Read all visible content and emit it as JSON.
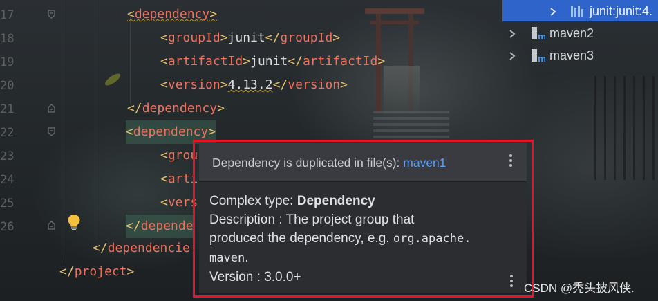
{
  "editor": {
    "line_numbers": [
      "17",
      "18",
      "19",
      "20",
      "21",
      "22",
      "23",
      "24",
      "25",
      "26"
    ],
    "lines": [
      {
        "indent": "      ",
        "open": "<",
        "name": "dependency",
        "close": ">",
        "text": "",
        "end_open": "",
        "end_name": "",
        "end_close": ""
      },
      {
        "indent": "        ",
        "open": "<",
        "name": "groupId",
        "close": ">",
        "text": "junit",
        "end_open": "</",
        "end_name": "groupId",
        "end_close": ">"
      },
      {
        "indent": "        ",
        "open": "<",
        "name": "artifactId",
        "close": ">",
        "text": "junit",
        "end_open": "</",
        "end_name": "artifactId",
        "end_close": ">"
      },
      {
        "indent": "        ",
        "open": "<",
        "name": "version",
        "close": ">",
        "text": "4.13.2",
        "end_open": "</",
        "end_name": "version",
        "end_close": ">"
      },
      {
        "indent": "      ",
        "open": "</",
        "name": "dependency",
        "close": ">",
        "text": "",
        "end_open": "",
        "end_name": "",
        "end_close": ""
      },
      {
        "indent": "      ",
        "open": "<",
        "name": "dependency",
        "close": ">",
        "text": "",
        "end_open": "",
        "end_name": "",
        "end_close": ""
      },
      {
        "indent": "        ",
        "open": "<",
        "name": "grou",
        "close": "",
        "text": "",
        "end_open": "",
        "end_name": "",
        "end_close": ""
      },
      {
        "indent": "        ",
        "open": "<",
        "name": "arti",
        "close": "",
        "text": "",
        "end_open": "",
        "end_name": "",
        "end_close": ""
      },
      {
        "indent": "        ",
        "open": "<",
        "name": "vers",
        "close": "",
        "text": "",
        "end_open": "",
        "end_name": "",
        "end_close": ""
      },
      {
        "indent": "      ",
        "open": "</",
        "name": "depende",
        "close": "",
        "text": "",
        "end_open": "",
        "end_name": "",
        "end_close": ""
      },
      {
        "indent": "    ",
        "open": "</",
        "name": "dependencie",
        "close": "",
        "text": "",
        "end_open": "",
        "end_name": "",
        "end_close": ""
      },
      {
        "indent": "  ",
        "open": "</",
        "name": "project",
        "close": ">",
        "text": "",
        "end_open": "",
        "end_name": "",
        "end_close": ""
      }
    ]
  },
  "project_tree": {
    "selected_item": "junit:junit:4.",
    "items": [
      "maven2",
      "maven3"
    ]
  },
  "popup": {
    "header_prefix": "Dependency is duplicated in file(s): ",
    "header_link": "maven1",
    "complex_type_label": "Complex type: ",
    "complex_type_value": "Dependency",
    "description_line1": "Description : The project group that",
    "description_line2_prefix": "produced the dependency, e.g. ",
    "description_code_part1": "org.apache.",
    "description_code_part2": "maven",
    "description_line3_suffix": ".",
    "version_line": "Version : 3.0.0+"
  },
  "watermark": "CSDN @秃头披风侠.",
  "colors": {
    "tag_name": "#f0715c",
    "bracket": "#e8bf6a",
    "selection": "#2f65ca",
    "popup_link": "#589df6",
    "highlight_frame": "#e0162b"
  },
  "icons": [
    "chevron-right-icon",
    "chevron-right-icon",
    "chevron-right-icon",
    "library-bars-icon",
    "maven-module-icon",
    "fold-marker-icon",
    "intention-bulb-icon",
    "more-options-icon"
  ]
}
